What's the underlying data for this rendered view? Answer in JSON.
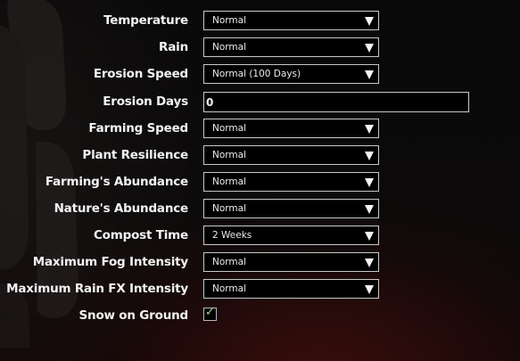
{
  "settings": {
    "temperature": {
      "label": "Temperature",
      "value": "Normal"
    },
    "rain": {
      "label": "Rain",
      "value": "Normal"
    },
    "erosion_speed": {
      "label": "Erosion Speed",
      "value": "Normal (100 Days)"
    },
    "erosion_days": {
      "label": "Erosion Days",
      "value": "0"
    },
    "farming_speed": {
      "label": "Farming Speed",
      "value": "Normal"
    },
    "plant_resilience": {
      "label": "Plant Resilience",
      "value": "Normal"
    },
    "farming_abundance": {
      "label": "Farming's Abundance",
      "value": "Normal"
    },
    "nature_abundance": {
      "label": "Nature's Abundance",
      "value": "Normal"
    },
    "compost_time": {
      "label": "Compost Time",
      "value": "2 Weeks"
    },
    "max_fog_intensity": {
      "label": "Maximum Fog Intensity",
      "value": "Normal"
    },
    "max_rain_fx_intensity": {
      "label": "Maximum Rain FX Intensity",
      "value": "Normal"
    },
    "snow_on_ground": {
      "label": "Snow on Ground",
      "checked": true,
      "check_glyph": "✓"
    }
  },
  "icons": {
    "dropdown_arrow": "triangle-down-icon",
    "checkbox_check": "checkmark-icon"
  },
  "colors": {
    "background": "#0b0909",
    "text": "#f2f2f2",
    "field_border": "#c8c8c8",
    "check": "#9ee08a"
  }
}
